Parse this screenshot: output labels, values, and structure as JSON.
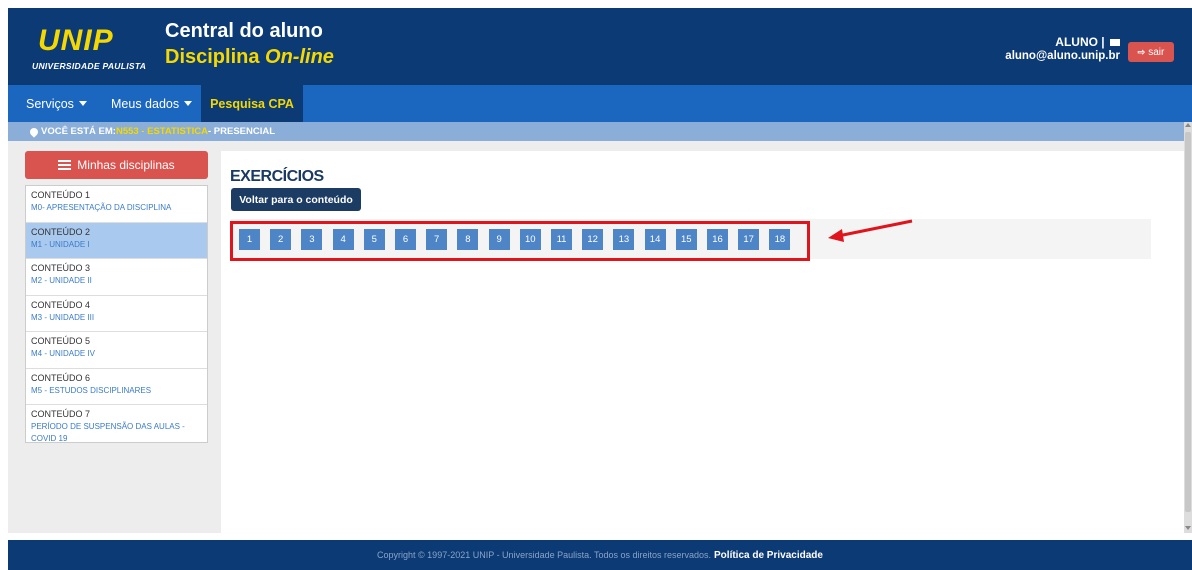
{
  "header": {
    "logo": "UNIP",
    "logo_sub": "UNIVERSIDADE PAULISTA",
    "title_line1": "Central do aluno",
    "title_line2_a": "Disciplina ",
    "title_line2_b": "On-line",
    "user_name": "ALUNO |",
    "user_email": "aluno@aluno.unip.br",
    "logout_label": "sair",
    "envelope_icon": "envelope-icon",
    "logout_icon": "sign-out-icon"
  },
  "nav": {
    "items": [
      {
        "label": "Serviços"
      },
      {
        "label": "Meus dados"
      }
    ],
    "cpa_label": "Pesquisa CPA"
  },
  "breadcrumb": {
    "prefix": "VOCÊ ESTÁ EM: ",
    "path": "N553 - ESTATISTICA",
    "suffix": " - PRESENCIAL",
    "icon": "map-pin-icon"
  },
  "sidebar": {
    "button_label": "Minhas disciplinas",
    "button_icon": "list-icon",
    "items": [
      {
        "title": "CONTEÚDO 1",
        "subtitle": "M0- APRESENTAÇÃO DA DISCIPLINA"
      },
      {
        "title": "CONTEÚDO 2",
        "subtitle": "M1 - UNIDADE I"
      },
      {
        "title": "CONTEÚDO 3",
        "subtitle": "M2 - UNIDADE II"
      },
      {
        "title": "CONTEÚDO 4",
        "subtitle": "M3 - UNIDADE III"
      },
      {
        "title": "CONTEÚDO 5",
        "subtitle": "M4 - UNIDADE IV"
      },
      {
        "title": "CONTEÚDO 6",
        "subtitle": "M5 - ESTUDOS DISCIPLINARES"
      },
      {
        "title": "CONTEÚDO 7",
        "subtitle": "PERÍODO DE SUSPENSÃO DAS AULAS - COVID 19"
      }
    ],
    "active_index": 1
  },
  "main": {
    "title": "EXERCÍCIOS",
    "back_button": "Voltar para o conteúdo",
    "exercises": [
      "1",
      "2",
      "3",
      "4",
      "5",
      "6",
      "7",
      "8",
      "9",
      "10",
      "11",
      "12",
      "13",
      "14",
      "15",
      "16",
      "17",
      "18"
    ]
  },
  "footer": {
    "copyright": "Copyright © 1997-2021 UNIP - Universidade Paulista. Todos os direitos reservados.",
    "policy": "Política de Privacidade"
  },
  "colors": {
    "header_bg": "#0c3a75",
    "nav_bg": "#1b67bf",
    "accent_yellow": "#f5d800",
    "button_red": "#d9534f",
    "exercise_blue": "#4d85c7",
    "annotation_red": "#e0141c"
  }
}
